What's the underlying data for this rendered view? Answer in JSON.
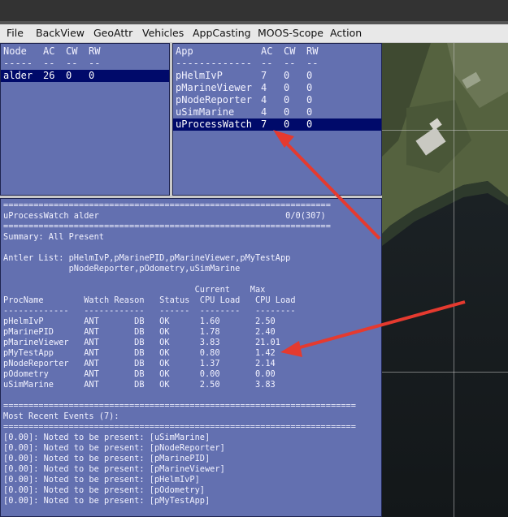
{
  "menubar": {
    "items": [
      "File",
      "BackView",
      "GeoAttr",
      "Vehicles",
      "AppCasting",
      "MOOS-Scope",
      "Action"
    ]
  },
  "node_panel": {
    "headers": [
      "Node",
      "AC",
      "CW",
      "RW"
    ],
    "separators": [
      "-----",
      "--",
      "--",
      "--"
    ],
    "rows": [
      {
        "cells": [
          "alder",
          "26",
          "0",
          "0"
        ],
        "selected": true
      }
    ]
  },
  "app_panel": {
    "headers": [
      "App",
      "AC",
      "CW",
      "RW"
    ],
    "separators": [
      "-------------",
      "--",
      "--",
      "--"
    ],
    "rows": [
      {
        "cells": [
          "pHelmIvP",
          "7",
          "0",
          "0"
        ],
        "selected": false
      },
      {
        "cells": [
          "pMarineViewer",
          "4",
          "0",
          "0"
        ],
        "selected": false
      },
      {
        "cells": [
          "pNodeReporter",
          "4",
          "0",
          "0"
        ],
        "selected": false
      },
      {
        "cells": [
          "uSimMarine",
          "4",
          "0",
          "0"
        ],
        "selected": false
      },
      {
        "cells": [
          "uProcessWatch",
          "7",
          "0",
          "0"
        ],
        "selected": true
      }
    ]
  },
  "report": {
    "lines": [
      "=================================================================",
      "uProcessWatch alder                                     0/0(307)",
      "=================================================================",
      "Summary: All Present",
      "",
      "Antler List: pHelmIvP,pMarinePID,pMarineViewer,pMyTestApp",
      "             pNodeReporter,pOdometry,uSimMarine",
      "",
      "                                      Current    Max",
      "ProcName        Watch Reason   Status  CPU Load   CPU Load",
      "-------------   ------------   ------  --------   --------",
      "pHelmIvP        ANT       DB   OK      1.60       2.50",
      "pMarinePID      ANT       DB   OK      1.78       2.40",
      "pMarineViewer   ANT       DB   OK      3.83       21.01",
      "pMyTestApp      ANT       DB   OK      0.80       1.42",
      "pNodeReporter   ANT       DB   OK      1.37       2.14",
      "pOdometry       ANT       DB   OK      0.00       0.00",
      "uSimMarine      ANT       DB   OK      2.50       3.83",
      "",
      "======================================================================",
      "Most Recent Events (7):",
      "======================================================================",
      "[0.00]: Noted to be present: [uSimMarine]",
      "[0.00]: Noted to be present: [pNodeReporter]",
      "[0.00]: Noted to be present: [pMarinePID]",
      "[0.00]: Noted to be present: [pMarineViewer]",
      "[0.00]: Noted to be present: [pHelmIvP]",
      "[0.00]: Noted to be present: [pOdometry]",
      "[0.00]: Noted to be present: [pMyTestApp]"
    ]
  },
  "colors": {
    "panel_bg": "#6370b0",
    "selection_bg": "#000a6a",
    "annotation_arrow": "#e53a2f"
  }
}
